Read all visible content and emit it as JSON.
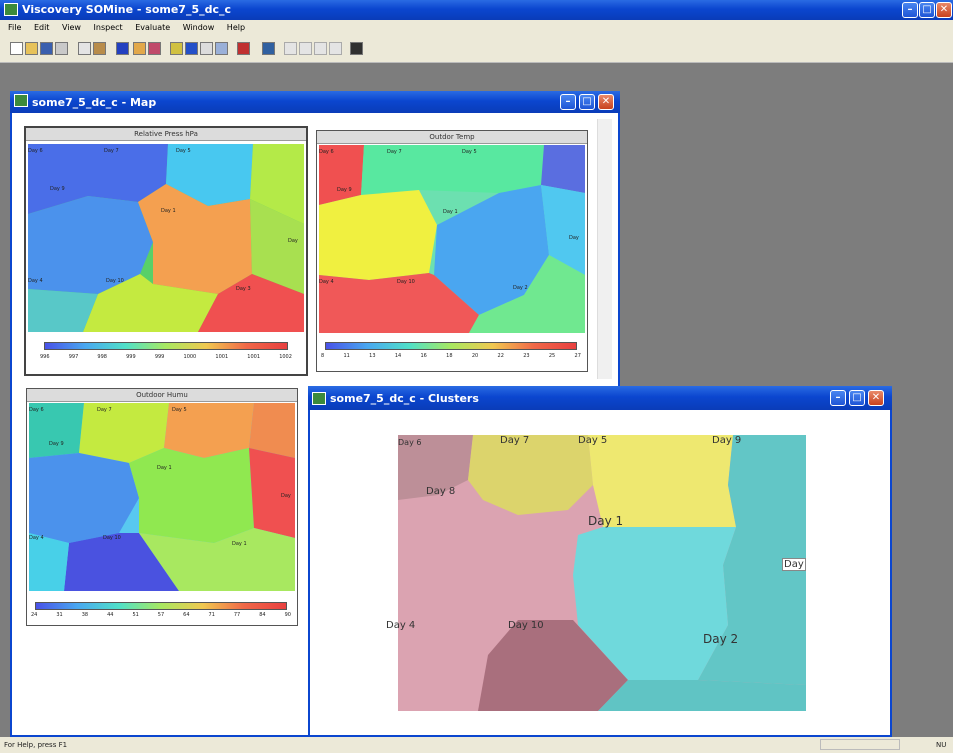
{
  "app": {
    "title": "Viscovery SOMine - some7_5_dc_c",
    "menu": [
      "File",
      "Edit",
      "View",
      "Inspect",
      "Evaluate",
      "Window",
      "Help"
    ],
    "status": "For Help, press F1",
    "status_right": "NU"
  },
  "map_window": {
    "title": "some7_5_dc_c - Map",
    "maps": [
      {
        "title": "Relative Press hPa",
        "ticks": [
          "996",
          "997",
          "998",
          "999",
          "999",
          "1000",
          "1001",
          "1001",
          "1002"
        ],
        "labels": [
          "Day 6",
          "Day 7",
          "Day 5",
          "Day 9",
          "Day 1",
          "Day 4",
          "Day 10",
          "Day 3",
          "Day"
        ]
      },
      {
        "title": "Outdor Temp",
        "ticks": [
          "8",
          "11",
          "13",
          "14",
          "16",
          "18",
          "20",
          "22",
          "23",
          "25",
          "27"
        ],
        "labels": [
          "Day 6",
          "Day 7",
          "Day 5",
          "Day 9",
          "Day 1",
          "Day 4",
          "Day 10",
          "Day 2",
          "Day"
        ]
      },
      {
        "title": "Outdoor Humu",
        "ticks": [
          "24",
          "31",
          "38",
          "44",
          "51",
          "57",
          "64",
          "71",
          "77",
          "84",
          "90"
        ],
        "labels": [
          "Day 6",
          "Day 7",
          "Day 5",
          "Day 9",
          "Day 1",
          "Day 4",
          "Day 10",
          "Day 1",
          "Day"
        ]
      }
    ]
  },
  "clusters_window": {
    "title": "some7_5_dc_c - Clusters",
    "labels": [
      "Day 6",
      "Day 7",
      "Day 5",
      "Day 9",
      "Day 8",
      "Day 1",
      "Day 4",
      "Day 10",
      "Day 2",
      "Day"
    ]
  },
  "colors": {
    "xp_blue": "#0b46cf",
    "cluster_mauve": "#bd8f98",
    "cluster_yellow": "#e6e170",
    "cluster_pink": "#dba3b1",
    "cluster_cyan": "#6fd9dc",
    "cluster_teal": "#62c6c6",
    "cluster_plum": "#a96f7d"
  }
}
